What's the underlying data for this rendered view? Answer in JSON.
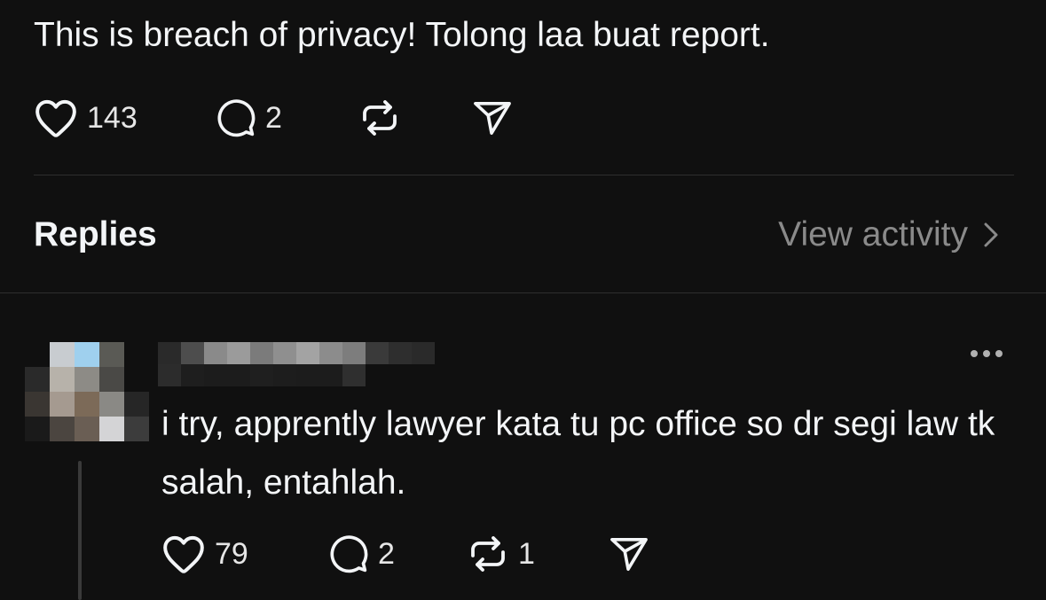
{
  "post": {
    "text": "This is breach of privacy! Tolong laa buat report.",
    "actions": {
      "like_icon": "heart-icon",
      "like_count": "143",
      "comment_icon": "comment-icon",
      "comment_count": "2",
      "repost_icon": "repost-icon",
      "share_icon": "share-icon"
    }
  },
  "replies_header": {
    "title": "Replies",
    "view_activity_label": "View activity",
    "chevron_icon": "chevron-right-icon"
  },
  "reply": {
    "avatar": "blurred-avatar",
    "username": "blurred-username",
    "more_icon": "more-options-icon",
    "text": "i try, apprently lawyer kata tu pc office so dr segi law tk salah, entahlah.",
    "actions": {
      "like_count": "79",
      "comment_count": "2",
      "repost_count": "1"
    }
  },
  "colors": {
    "background": "#101010",
    "text_primary": "#f3f5f7",
    "text_secondary": "#8a8a8a",
    "divider": "#2e2e2e"
  }
}
